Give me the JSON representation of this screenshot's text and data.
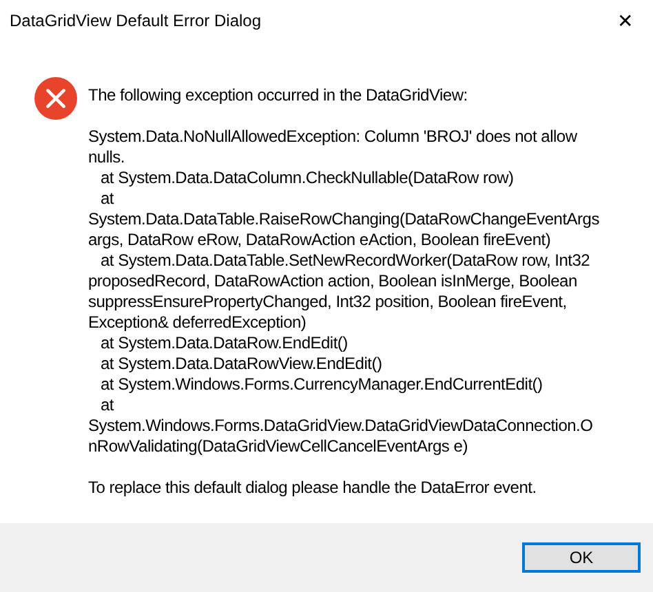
{
  "window": {
    "title": "DataGridView Default Error Dialog",
    "close": "✕"
  },
  "message": {
    "heading": "The following exception occurred in the DataGridView:",
    "details": [
      {
        "text": "System.Data.NoNullAllowedException: Column 'BROJ' does not allow",
        "indent": false
      },
      {
        "text": "nulls.",
        "indent": false
      },
      {
        "text": "at System.Data.DataColumn.CheckNullable(DataRow row)",
        "indent": true
      },
      {
        "text": "at",
        "indent": true
      },
      {
        "text": "System.Data.DataTable.RaiseRowChanging(DataRowChangeEventArgs",
        "indent": false
      },
      {
        "text": "args, DataRow eRow, DataRowAction eAction, Boolean fireEvent)",
        "indent": false
      },
      {
        "text": "at System.Data.DataTable.SetNewRecordWorker(DataRow row, Int32",
        "indent": true
      },
      {
        "text": "proposedRecord, DataRowAction action, Boolean isInMerge, Boolean",
        "indent": false
      },
      {
        "text": "suppressEnsurePropertyChanged, Int32 position, Boolean fireEvent,",
        "indent": false
      },
      {
        "text": "Exception& deferredException)",
        "indent": false
      },
      {
        "text": "at System.Data.DataRow.EndEdit()",
        "indent": true
      },
      {
        "text": "at System.Data.DataRowView.EndEdit()",
        "indent": true
      },
      {
        "text": "at System.Windows.Forms.CurrencyManager.EndCurrentEdit()",
        "indent": true
      },
      {
        "text": "at",
        "indent": true
      },
      {
        "text": "System.Windows.Forms.DataGridView.DataGridViewDataConnection.O",
        "indent": false
      },
      {
        "text": "nRowValidating(DataGridViewCellCancelEventArgs e)",
        "indent": false
      }
    ],
    "footer": "To replace this default dialog please handle the DataError event."
  },
  "buttons": [
    {
      "label": "OK",
      "default": true
    }
  ]
}
